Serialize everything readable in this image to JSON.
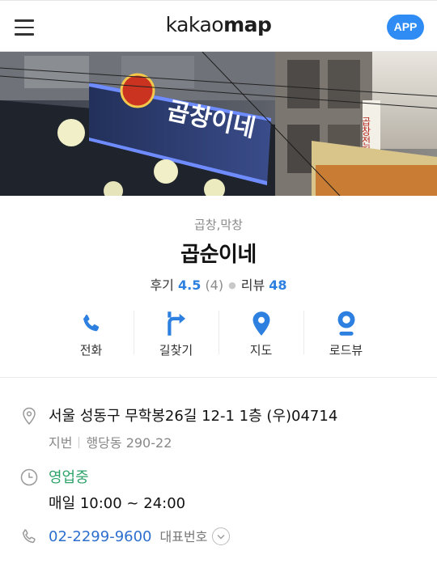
{
  "header": {
    "logo_part1": "kakao",
    "logo_part2": "map",
    "app_button": "APP"
  },
  "photo": {
    "sign_text": "곱창이네",
    "side_sign_text": "곱창전집"
  },
  "place": {
    "category": "곱창,막창",
    "name": "곱순이네",
    "review_label": "후기",
    "review_score": "4.5",
    "review_count": "(4)",
    "blog_label": "리뷰",
    "blog_count": "48"
  },
  "actions": [
    {
      "label": "전화",
      "icon": "phone-icon"
    },
    {
      "label": "길찾기",
      "icon": "directions-icon"
    },
    {
      "label": "지도",
      "icon": "map-pin-icon"
    },
    {
      "label": "로드뷰",
      "icon": "roadview-icon"
    }
  ],
  "details": {
    "address": "서울 성동구 무학봉26길 12-1 1층 (우)04714",
    "lot_label": "지번",
    "lot_address": "행당동 290-22",
    "status": "영업중",
    "hours": "매일 10:00 ~ 24:00",
    "phone": "02-2299-9600",
    "phone_type": "대표번호"
  },
  "colors": {
    "accent_blue": "#2f8cf5",
    "text_blue": "#2d7fe0",
    "open_green": "#2ea36a"
  }
}
